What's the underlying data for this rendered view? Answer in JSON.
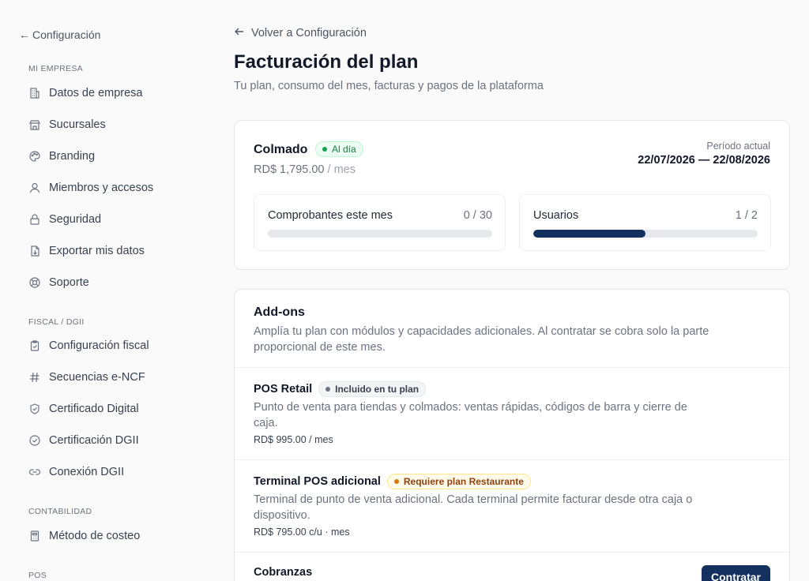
{
  "sidebar": {
    "back_label": "Configuración",
    "sections": {
      "mi_empresa": "MI EMPRESA",
      "fiscal": "FISCAL / DGII",
      "contabilidad": "CONTABILIDAD",
      "pos": "POS"
    },
    "items": {
      "datos_empresa": "Datos de empresa",
      "sucursales": "Sucursales",
      "branding": "Branding",
      "miembros": "Miembros y accesos",
      "seguridad": "Seguridad",
      "exportar": "Exportar mis datos",
      "soporte": "Soporte",
      "config_fiscal": "Configuración fiscal",
      "secuencias": "Secuencias e-NCF",
      "certificado": "Certificado Digital",
      "certificacion": "Certificación DGII",
      "conexion": "Conexión DGII",
      "costeo": "Método de costeo"
    }
  },
  "header": {
    "back_label": "Volver a Configuración",
    "title": "Facturación del plan",
    "subtitle": "Tu plan, consumo del mes, facturas y pagos de la plataforma"
  },
  "plan": {
    "name": "Colmado",
    "status": "Al día",
    "price": "RD$ 1,795.00",
    "price_unit": "/ mes",
    "period_label": "Período actual",
    "period_value": "22/07/2026 — 22/08/2026",
    "meters": [
      {
        "label": "Comprobantes este mes",
        "count": "0 / 30",
        "used": 0,
        "limit": 30
      },
      {
        "label": "Usuarios",
        "count": "1 / 2",
        "used": 1,
        "limit": 2
      }
    ]
  },
  "addons": {
    "title": "Add-ons",
    "description": "Amplía tu plan con módulos y capacidades adicionales. Al contratar se cobra solo la parte proporcional de este mes.",
    "items": [
      {
        "name": "POS Retail",
        "badge": "Incluido en tu plan",
        "description": "Punto de venta para tiendas y colmados: ventas rápidas, códigos de barra y cierre de caja.",
        "price": "RD$ 995.00 / mes"
      },
      {
        "name": "Terminal POS adicional",
        "badge": "Requiere plan Restaurante",
        "description": "Terminal de punto de venta adicional. Cada terminal permite facturar desde otra caja o dispositivo.",
        "price": "RD$ 795.00 c/u · mes"
      },
      {
        "name": "Cobranzas",
        "button": "Contratar"
      }
    ]
  },
  "colors": {
    "primary": "#14305e",
    "success": "#16a34a",
    "warning": "#d97706"
  }
}
